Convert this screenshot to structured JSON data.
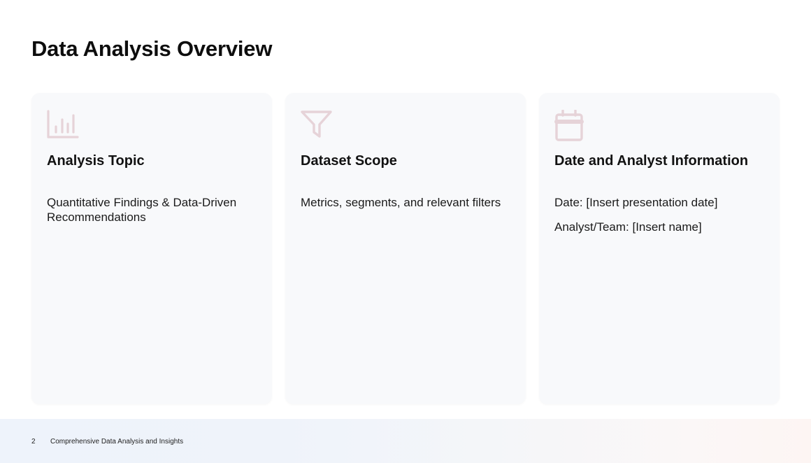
{
  "slide": {
    "title": "Data Analysis Overview"
  },
  "cards": [
    {
      "icon": "bar-chart-icon",
      "title": "Analysis Topic",
      "lines": [
        "Quantitative Findings & Data-Driven Recommendations"
      ]
    },
    {
      "icon": "funnel-filter-icon",
      "title": "Dataset Scope",
      "lines": [
        "Metrics, segments, and relevant filters"
      ]
    },
    {
      "icon": "calendar-icon",
      "title": "Date and Analyst Information",
      "lines": [
        "Date: [Insert presentation date]",
        "Analyst/Team: [Insert name]"
      ]
    }
  ],
  "footer": {
    "page_number": "2",
    "text": "Comprehensive Data Analysis and Insights"
  },
  "colors": {
    "icon_stroke": "#e6d3d8",
    "card_background": "#f8f9fb",
    "title_text": "#0d0d0d"
  }
}
